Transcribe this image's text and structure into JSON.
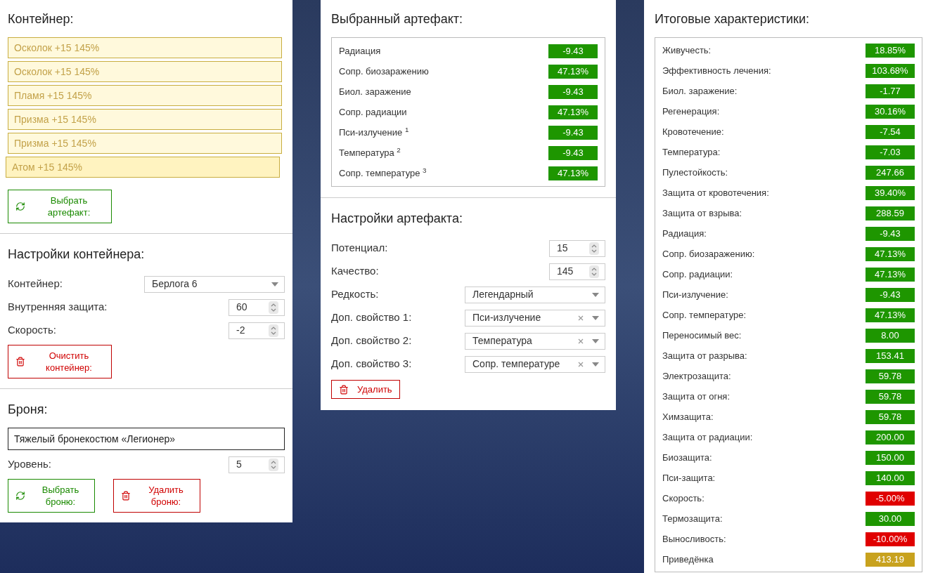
{
  "container": {
    "title": "Контейнер:",
    "slots": [
      {
        "label": "Осколок +15 145%",
        "selected": false
      },
      {
        "label": "Осколок +15 145%",
        "selected": false
      },
      {
        "label": "Пламя +15 145%",
        "selected": false
      },
      {
        "label": "Призма +15 145%",
        "selected": false
      },
      {
        "label": "Призма +15 145%",
        "selected": false
      },
      {
        "label": "Атом +15 145%",
        "selected": true
      }
    ],
    "button": {
      "label": "Выбрать артефакт:",
      "kind": "select"
    }
  },
  "container_settings": {
    "title": "Настройки контейнера:",
    "fields": [
      {
        "kind": "select",
        "label": "Контейнер:",
        "value": "Берлога 6",
        "clearable": false
      },
      {
        "kind": "number",
        "label": "Внутренняя защита:",
        "value": "60"
      },
      {
        "kind": "number",
        "label": "Скорость:",
        "value": "-2"
      }
    ],
    "button": {
      "label": "Очистить контейнер:",
      "kind": "delete"
    }
  },
  "armor": {
    "title": "Броня:",
    "name": "Тяжелый бронекостюм «Легионер»",
    "fields": [
      {
        "kind": "number",
        "label": "Уровень:",
        "value": "5"
      }
    ],
    "buttons": [
      {
        "label": "Выбрать броню:",
        "kind": "select"
      },
      {
        "label": "Удалить броню:",
        "kind": "delete"
      }
    ]
  },
  "selected_artifact": {
    "title": "Выбранный артефакт:",
    "stats": [
      {
        "name": "Радиация",
        "value": "-9.43",
        "color": "#1e9600"
      },
      {
        "name": "Сопр. биозаражению",
        "value": "47.13%",
        "color": "#1e9600"
      },
      {
        "name": "Биол. заражение",
        "value": "-9.43",
        "color": "#1e9600"
      },
      {
        "name": "Сопр. радиации",
        "value": "47.13%",
        "color": "#1e9600"
      },
      {
        "name": "Пси-излучение $^{1}$",
        "value": "-9.43",
        "color": "#1e9600"
      },
      {
        "name": "Температура $^{2}$",
        "value": "-9.43",
        "color": "#1e9600"
      },
      {
        "name": "Сопр. температуре $^{3}$",
        "value": "47.13%",
        "color": "#1e9600"
      }
    ]
  },
  "artifact_settings": {
    "title": "Настройки артефакта:",
    "fields": [
      {
        "kind": "number",
        "label": "Потенциал:",
        "value": "15"
      },
      {
        "kind": "number",
        "label": "Качество:",
        "value": "145"
      },
      {
        "kind": "select",
        "label": "Редкость:",
        "value": "Легендарный",
        "clearable": false
      },
      {
        "kind": "select",
        "label": "Доп. свойство 1:",
        "value": "Пси-излучение",
        "clearable": true
      },
      {
        "kind": "select",
        "label": "Доп. свойство 2:",
        "value": "Температура",
        "clearable": true
      },
      {
        "kind": "select",
        "label": "Доп. свойство 3:",
        "value": "Сопр. температуре",
        "clearable": true
      }
    ],
    "button": {
      "label": "Удалить",
      "kind": "delete"
    }
  },
  "totals": {
    "title": "Итоговые характеристики:",
    "stats": [
      {
        "name": "Живучесть:",
        "value": "18.85%",
        "color": "#1e9600"
      },
      {
        "name": "Эффективность лечения:",
        "value": "103.68%",
        "color": "#1e9600"
      },
      {
        "name": "Биол. заражение:",
        "value": "-1.77",
        "color": "#1e9600"
      },
      {
        "name": "Регенерация:",
        "value": "30.16%",
        "color": "#1e9600"
      },
      {
        "name": "Кровотечение:",
        "value": "-7.54",
        "color": "#1e9600"
      },
      {
        "name": "Температура:",
        "value": "-7.03",
        "color": "#1e9600"
      },
      {
        "name": "Пулестойкость:",
        "value": "247.66",
        "color": "#1e9600"
      },
      {
        "name": "Защита от кровотечения:",
        "value": "39.40%",
        "color": "#1e9600"
      },
      {
        "name": "Защита от взрыва:",
        "value": "288.59",
        "color": "#1e9600"
      },
      {
        "name": "Радиация:",
        "value": "-9.43",
        "color": "#1e9600"
      },
      {
        "name": "Сопр. биозаражению:",
        "value": "47.13%",
        "color": "#1e9600"
      },
      {
        "name": "Сопр. радиации:",
        "value": "47.13%",
        "color": "#1e9600"
      },
      {
        "name": "Пси-излучение:",
        "value": "-9.43",
        "color": "#1e9600"
      },
      {
        "name": "Сопр. температуре:",
        "value": "47.13%",
        "color": "#1e9600"
      },
      {
        "name": "Переносимый вес:",
        "value": "8.00",
        "color": "#1e9600"
      },
      {
        "name": "Защита от разрыва:",
        "value": "153.41",
        "color": "#1e9600"
      },
      {
        "name": "Электрозащита:",
        "value": "59.78",
        "color": "#1e9600"
      },
      {
        "name": "Защита от огня:",
        "value": "59.78",
        "color": "#1e9600"
      },
      {
        "name": "Химзащита:",
        "value": "59.78",
        "color": "#1e9600"
      },
      {
        "name": "Защита от радиации:",
        "value": "200.00",
        "color": "#1e9600"
      },
      {
        "name": "Биозащита:",
        "value": "150.00",
        "color": "#1e9600"
      },
      {
        "name": "Пси-защита:",
        "value": "140.00",
        "color": "#1e9600"
      },
      {
        "name": "Скорость:",
        "value": "-5.00%",
        "color": "#e00000"
      },
      {
        "name": "Термозащита:",
        "value": "30.00",
        "color": "#1e9600"
      },
      {
        "name": "Выносливость:",
        "value": "-10.00%",
        "color": "#e00000"
      },
      {
        "name": "Приведёнка",
        "value": "413.19",
        "color": "#c8a21e"
      }
    ]
  }
}
